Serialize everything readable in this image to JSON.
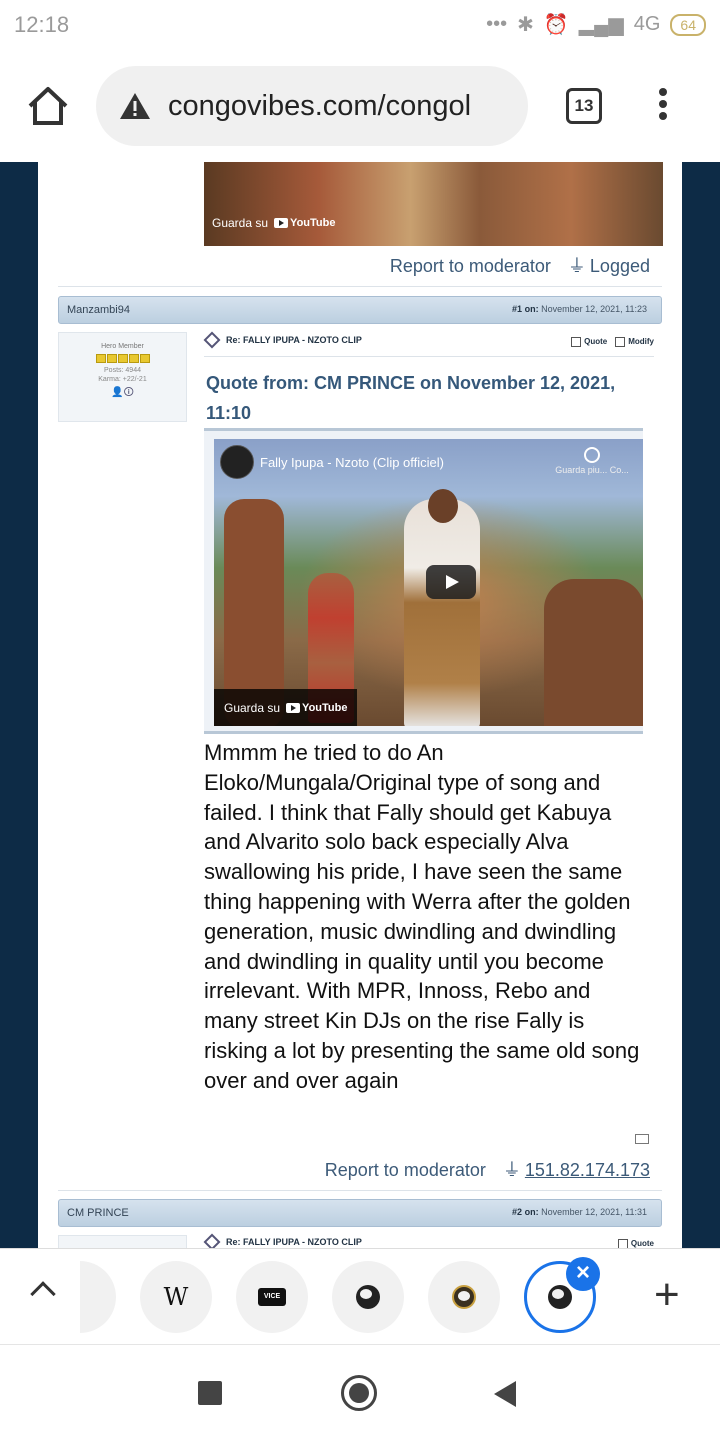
{
  "status_bar": {
    "time": "12:18",
    "network": "4G",
    "battery": "64"
  },
  "browser": {
    "url": "congovibes.com/congol",
    "tab_count": "13"
  },
  "top_video": {
    "watch_on": "Guarda su",
    "platform": "YouTube"
  },
  "prev_post_footer": {
    "report": "Report to moderator",
    "logged": "Logged"
  },
  "post1": {
    "author": "Manzambi94",
    "number": "#1",
    "on_label": "on:",
    "date": "November 12, 2021, 11:23",
    "rank": "Hero Member",
    "posts": "Posts: 4944",
    "karma": "Karma: +22/-21",
    "subject": "Re: FALLY IPUPA - NZOTO CLIP",
    "quote_label": "Quote",
    "modify_label": "Modify",
    "quote_header": "Quote from: CM PRINCE on November 12, 2021, 11:10",
    "video": {
      "title": "Fally Ipupa - Nzoto (Clip officiel)",
      "watch_later": "Guarda piu...",
      "share": "Co...",
      "watch_on": "Guarda su",
      "platform": "YouTube"
    },
    "body": "Mmmm he tried to do An Eloko/Mungala/Original type of song and failed. I think that Fally should get Kabuya and Alvarito solo back especially Alva swallowing his pride, I have seen the same thing happening with Werra after the golden generation, music dwindling and dwindling and dwindling in quality until you become irrelevant. With MPR, Innoss, Rebo and many street Kin DJs on the rise Fally is risking a lot by presenting the same old song over and over again",
    "report": "Report to moderator",
    "ip": "151.82.174.173"
  },
  "post2": {
    "author": "CM PRINCE",
    "number": "#2",
    "on_label": "on:",
    "date": "November 12, 2021, 11:31",
    "subject": "Re: FALLY IPUPA - NZOTO CLIP",
    "quote_label": "Quote"
  },
  "tab_strip": {
    "wiki_glyph": "W",
    "vice_label": "VICE",
    "close": "×",
    "new_tab": "+"
  },
  "colors": {
    "page_bg": "#0d2b46",
    "accent": "#1a73e8",
    "link": "#3c5a78"
  }
}
